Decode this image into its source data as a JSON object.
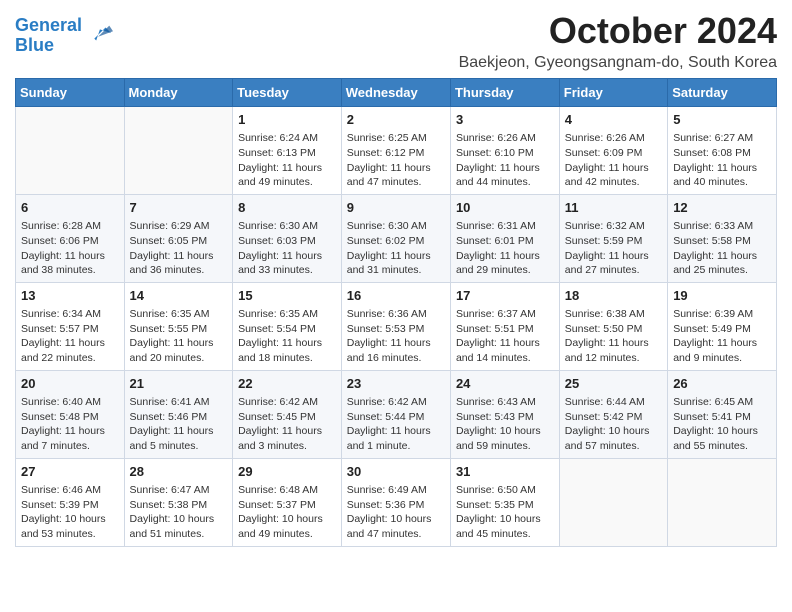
{
  "logo": {
    "line1": "General",
    "line2": "Blue"
  },
  "title": "October 2024",
  "subtitle": "Baekjeon, Gyeongsangnam-do, South Korea",
  "columns": [
    "Sunday",
    "Monday",
    "Tuesday",
    "Wednesday",
    "Thursday",
    "Friday",
    "Saturday"
  ],
  "weeks": [
    [
      {
        "day": "",
        "content": ""
      },
      {
        "day": "",
        "content": ""
      },
      {
        "day": "1",
        "content": "Sunrise: 6:24 AM\nSunset: 6:13 PM\nDaylight: 11 hours and 49 minutes."
      },
      {
        "day": "2",
        "content": "Sunrise: 6:25 AM\nSunset: 6:12 PM\nDaylight: 11 hours and 47 minutes."
      },
      {
        "day": "3",
        "content": "Sunrise: 6:26 AM\nSunset: 6:10 PM\nDaylight: 11 hours and 44 minutes."
      },
      {
        "day": "4",
        "content": "Sunrise: 6:26 AM\nSunset: 6:09 PM\nDaylight: 11 hours and 42 minutes."
      },
      {
        "day": "5",
        "content": "Sunrise: 6:27 AM\nSunset: 6:08 PM\nDaylight: 11 hours and 40 minutes."
      }
    ],
    [
      {
        "day": "6",
        "content": "Sunrise: 6:28 AM\nSunset: 6:06 PM\nDaylight: 11 hours and 38 minutes."
      },
      {
        "day": "7",
        "content": "Sunrise: 6:29 AM\nSunset: 6:05 PM\nDaylight: 11 hours and 36 minutes."
      },
      {
        "day": "8",
        "content": "Sunrise: 6:30 AM\nSunset: 6:03 PM\nDaylight: 11 hours and 33 minutes."
      },
      {
        "day": "9",
        "content": "Sunrise: 6:30 AM\nSunset: 6:02 PM\nDaylight: 11 hours and 31 minutes."
      },
      {
        "day": "10",
        "content": "Sunrise: 6:31 AM\nSunset: 6:01 PM\nDaylight: 11 hours and 29 minutes."
      },
      {
        "day": "11",
        "content": "Sunrise: 6:32 AM\nSunset: 5:59 PM\nDaylight: 11 hours and 27 minutes."
      },
      {
        "day": "12",
        "content": "Sunrise: 6:33 AM\nSunset: 5:58 PM\nDaylight: 11 hours and 25 minutes."
      }
    ],
    [
      {
        "day": "13",
        "content": "Sunrise: 6:34 AM\nSunset: 5:57 PM\nDaylight: 11 hours and 22 minutes."
      },
      {
        "day": "14",
        "content": "Sunrise: 6:35 AM\nSunset: 5:55 PM\nDaylight: 11 hours and 20 minutes."
      },
      {
        "day": "15",
        "content": "Sunrise: 6:35 AM\nSunset: 5:54 PM\nDaylight: 11 hours and 18 minutes."
      },
      {
        "day": "16",
        "content": "Sunrise: 6:36 AM\nSunset: 5:53 PM\nDaylight: 11 hours and 16 minutes."
      },
      {
        "day": "17",
        "content": "Sunrise: 6:37 AM\nSunset: 5:51 PM\nDaylight: 11 hours and 14 minutes."
      },
      {
        "day": "18",
        "content": "Sunrise: 6:38 AM\nSunset: 5:50 PM\nDaylight: 11 hours and 12 minutes."
      },
      {
        "day": "19",
        "content": "Sunrise: 6:39 AM\nSunset: 5:49 PM\nDaylight: 11 hours and 9 minutes."
      }
    ],
    [
      {
        "day": "20",
        "content": "Sunrise: 6:40 AM\nSunset: 5:48 PM\nDaylight: 11 hours and 7 minutes."
      },
      {
        "day": "21",
        "content": "Sunrise: 6:41 AM\nSunset: 5:46 PM\nDaylight: 11 hours and 5 minutes."
      },
      {
        "day": "22",
        "content": "Sunrise: 6:42 AM\nSunset: 5:45 PM\nDaylight: 11 hours and 3 minutes."
      },
      {
        "day": "23",
        "content": "Sunrise: 6:42 AM\nSunset: 5:44 PM\nDaylight: 11 hours and 1 minute."
      },
      {
        "day": "24",
        "content": "Sunrise: 6:43 AM\nSunset: 5:43 PM\nDaylight: 10 hours and 59 minutes."
      },
      {
        "day": "25",
        "content": "Sunrise: 6:44 AM\nSunset: 5:42 PM\nDaylight: 10 hours and 57 minutes."
      },
      {
        "day": "26",
        "content": "Sunrise: 6:45 AM\nSunset: 5:41 PM\nDaylight: 10 hours and 55 minutes."
      }
    ],
    [
      {
        "day": "27",
        "content": "Sunrise: 6:46 AM\nSunset: 5:39 PM\nDaylight: 10 hours and 53 minutes."
      },
      {
        "day": "28",
        "content": "Sunrise: 6:47 AM\nSunset: 5:38 PM\nDaylight: 10 hours and 51 minutes."
      },
      {
        "day": "29",
        "content": "Sunrise: 6:48 AM\nSunset: 5:37 PM\nDaylight: 10 hours and 49 minutes."
      },
      {
        "day": "30",
        "content": "Sunrise: 6:49 AM\nSunset: 5:36 PM\nDaylight: 10 hours and 47 minutes."
      },
      {
        "day": "31",
        "content": "Sunrise: 6:50 AM\nSunset: 5:35 PM\nDaylight: 10 hours and 45 minutes."
      },
      {
        "day": "",
        "content": ""
      },
      {
        "day": "",
        "content": ""
      }
    ]
  ]
}
